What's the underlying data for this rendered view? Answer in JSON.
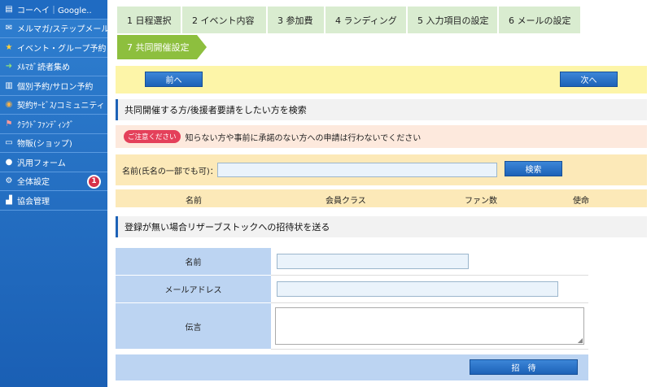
{
  "sidebar": {
    "items": [
      {
        "label": "コーヘイ｜Google..",
        "icon": "document-icon"
      },
      {
        "label": "メルマガ/ステップメール",
        "icon": "mail-icon"
      },
      {
        "label": "イベント・グループ予約",
        "icon": "star-icon"
      },
      {
        "label": "ﾒﾙﾏｶﾞ読者集め",
        "icon": "arrow-icon"
      },
      {
        "label": "個別予約/サロン予約",
        "icon": "building-icon"
      },
      {
        "label": "契約ｻｰﾋﾞｽ/コミュニティ",
        "icon": "handshake-icon"
      },
      {
        "label": "ｸﾗｳﾄﾞﾌｧﾝﾃﾞｨﾝｸﾞ",
        "icon": "flag-icon"
      },
      {
        "label": "物販(ショップ)",
        "icon": "cart-icon"
      },
      {
        "label": "汎用フォーム",
        "icon": "chat-icon"
      },
      {
        "label": "全体設定",
        "icon": "gear-icon",
        "badge": "1"
      },
      {
        "label": "協会管理",
        "icon": "chart-icon"
      }
    ]
  },
  "steps": [
    {
      "label": "1 日程選択"
    },
    {
      "label": "2 イベント内容"
    },
    {
      "label": "3 参加費"
    },
    {
      "label": "4 ランディング"
    },
    {
      "label": "5 入力項目の設定"
    },
    {
      "label": "6 メールの設定"
    },
    {
      "label": "7 共同開催設定"
    }
  ],
  "nav": {
    "prev": "前へ",
    "next": "次へ"
  },
  "search_section": {
    "title": "共同開催する方/後援者要請をしたい方を検索",
    "caution_badge": "ご注意ください",
    "notice": "知らない方や事前に承諾のない方への申請は行わないでください",
    "name_label": "名前(氏名の一部でも可)：",
    "search_button": "検索",
    "columns": [
      "名前",
      "会員クラス",
      "ファン数",
      "使命"
    ]
  },
  "invite_section": {
    "title": "登録が無い場合リザーブストックへの招待状を送る",
    "name_label": "名前",
    "email_label": "メールアドレス",
    "message_label": "伝言",
    "invite_button": "招　待"
  },
  "colors": {
    "sidebar": "#1a5fb4",
    "step_active": "#8dbf3e",
    "step": "#d9ecd0",
    "accent": "#1d62b7"
  }
}
